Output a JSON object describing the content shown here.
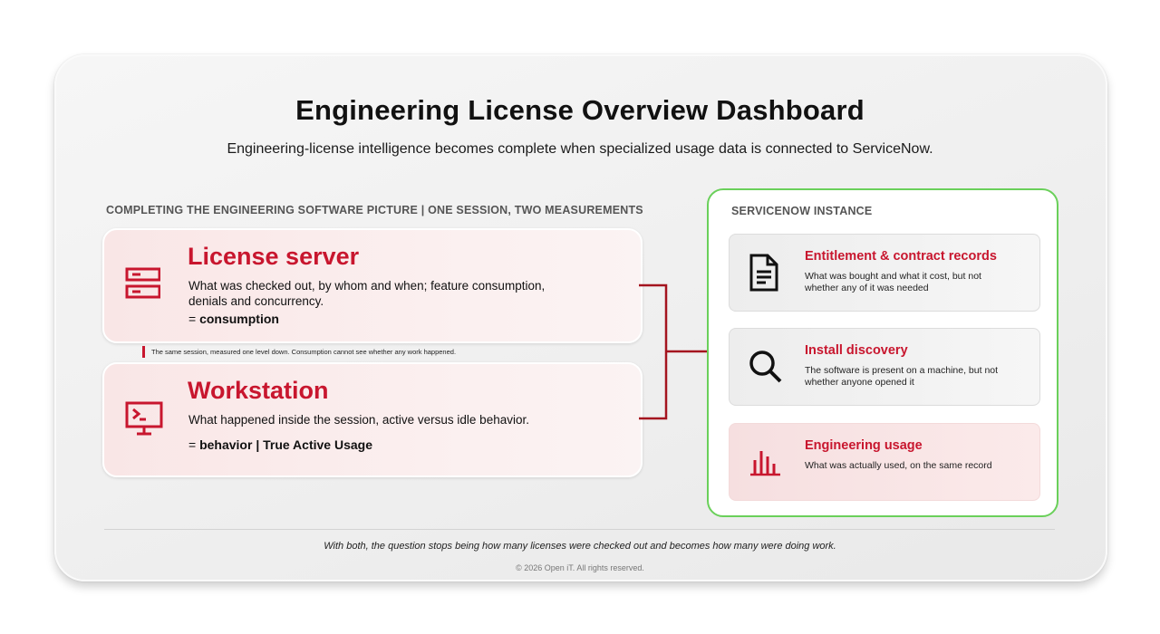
{
  "header": {
    "title": "Engineering License Overview Dashboard",
    "subtitle": "Engineering-license intelligence becomes complete when specialized usage data is connected to ServiceNow."
  },
  "left_section": {
    "label": "COMPLETING THE ENGINEERING SOFTWARE PICTURE | ONE SESSION, TWO MEASUREMENTS",
    "panels": [
      {
        "title": "License server",
        "icon": "server-icon",
        "description": "What was checked out, by whom and when; feature consumption, denials and concurrency.",
        "result_prefix": "= ",
        "result": "consumption"
      },
      {
        "title": "Workstation",
        "icon": "monitor-terminal-icon",
        "description": "What happened inside the session, active versus idle behavior.",
        "result_prefix": "= ",
        "result": "behavior | True Active Usage"
      }
    ],
    "note": "The same session, measured one level down. Consumption cannot see whether any work happened."
  },
  "servicenow": {
    "label": "SERVICENOW INSTANCE",
    "cards": [
      {
        "title": "Entitlement & contract records",
        "icon": "document-icon",
        "description": "What was bought and what it cost, but not whether any of it was needed"
      },
      {
        "title": "Install discovery",
        "icon": "search-icon",
        "description": "The software is present on a machine, but not whether anyone opened it"
      },
      {
        "title": "Engineering usage",
        "icon": "bar-chart-icon",
        "description": "What was actually used, on the same record"
      }
    ]
  },
  "footer": {
    "text": "With both, the question stops being how many licenses were checked out and becomes how many were doing work.",
    "copyright": "© 2026 Open iT. All rights reserved."
  },
  "colors": {
    "accent_red": "#c8162e",
    "servicenow_border": "#6ad05a",
    "panel_background": "#f9e6e6"
  }
}
